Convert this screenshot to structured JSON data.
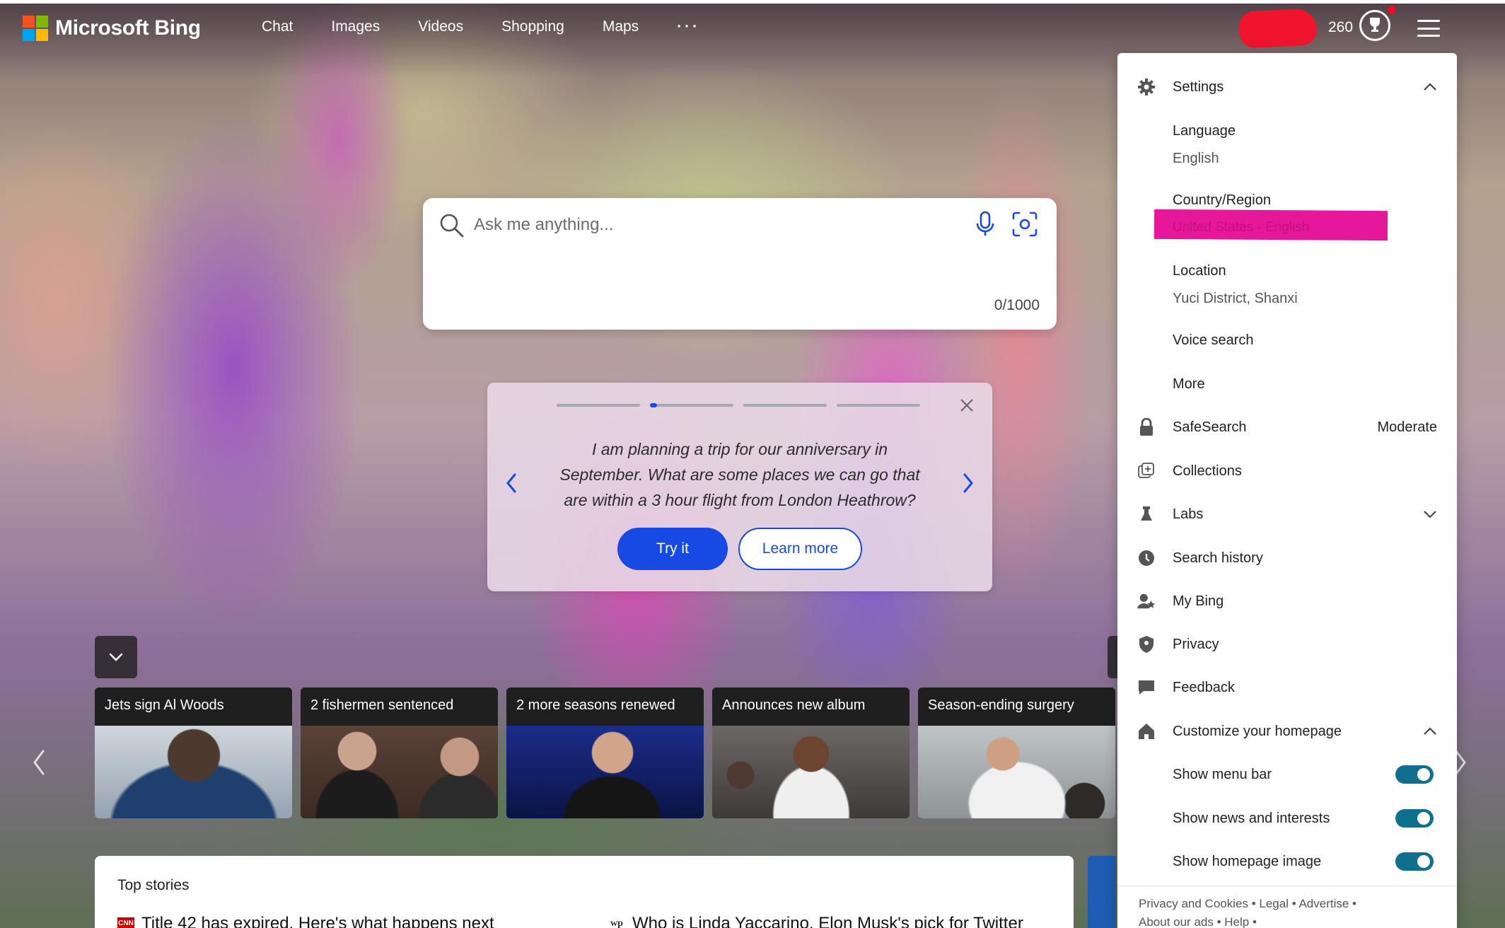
{
  "header": {
    "brand": "Microsoft Bing",
    "nav": [
      "Chat",
      "Images",
      "Videos",
      "Shopping",
      "Maps",
      "···"
    ],
    "points": "260"
  },
  "search": {
    "placeholder": "Ask me anything...",
    "value": "",
    "counter": "0/1000"
  },
  "prompt_card": {
    "text": "I am planning a trip for our anniversary in September. What are some places we can go that are within a 3 hour flight from London Heathrow?",
    "try_label": "Try it",
    "learn_label": "Learn more"
  },
  "news": [
    {
      "title": "Jets sign Al Woods"
    },
    {
      "title": "2 fishermen sentenced"
    },
    {
      "title": "2 more seasons renewed"
    },
    {
      "title": "Announces new album"
    },
    {
      "title": "Season-ending surgery"
    }
  ],
  "top_stories": {
    "title": "Top stories",
    "items": [
      {
        "source": "CNN",
        "headline": "Title 42 has expired. Here's what happens next"
      },
      {
        "source": "wp",
        "headline": "Who is Linda Yaccarino, Elon Musk's pick for Twitter"
      }
    ]
  },
  "settings": {
    "title": "Settings",
    "language_label": "Language",
    "language_value": "English",
    "country_label": "Country/Region",
    "country_value": "United States - English",
    "location_label": "Location",
    "location_value": "Yuci District, Shanxi",
    "voice_search": "Voice search",
    "more": "More",
    "safesearch_label": "SafeSearch",
    "safesearch_value": "Moderate",
    "collections": "Collections",
    "labs": "Labs",
    "search_history": "Search history",
    "my_bing": "My Bing",
    "privacy": "Privacy",
    "feedback": "Feedback",
    "customize": "Customize your homepage",
    "show_menu_bar": "Show menu bar",
    "show_news": "Show news and interests",
    "show_homepage_image": "Show homepage image",
    "toggles": {
      "menu_bar": true,
      "news": true,
      "homepage_image": true
    }
  },
  "footer": {
    "privacy_cookies": "Privacy and Cookies",
    "legal": "Legal",
    "advertise": "Advertise",
    "about_ads": "About our ads",
    "help": "Help"
  },
  "colors": {
    "accent": "#174ae4",
    "toggle_on": "#0f6f8f",
    "redaction_pink": "#e6179b",
    "redaction_red": "#f0142d"
  }
}
